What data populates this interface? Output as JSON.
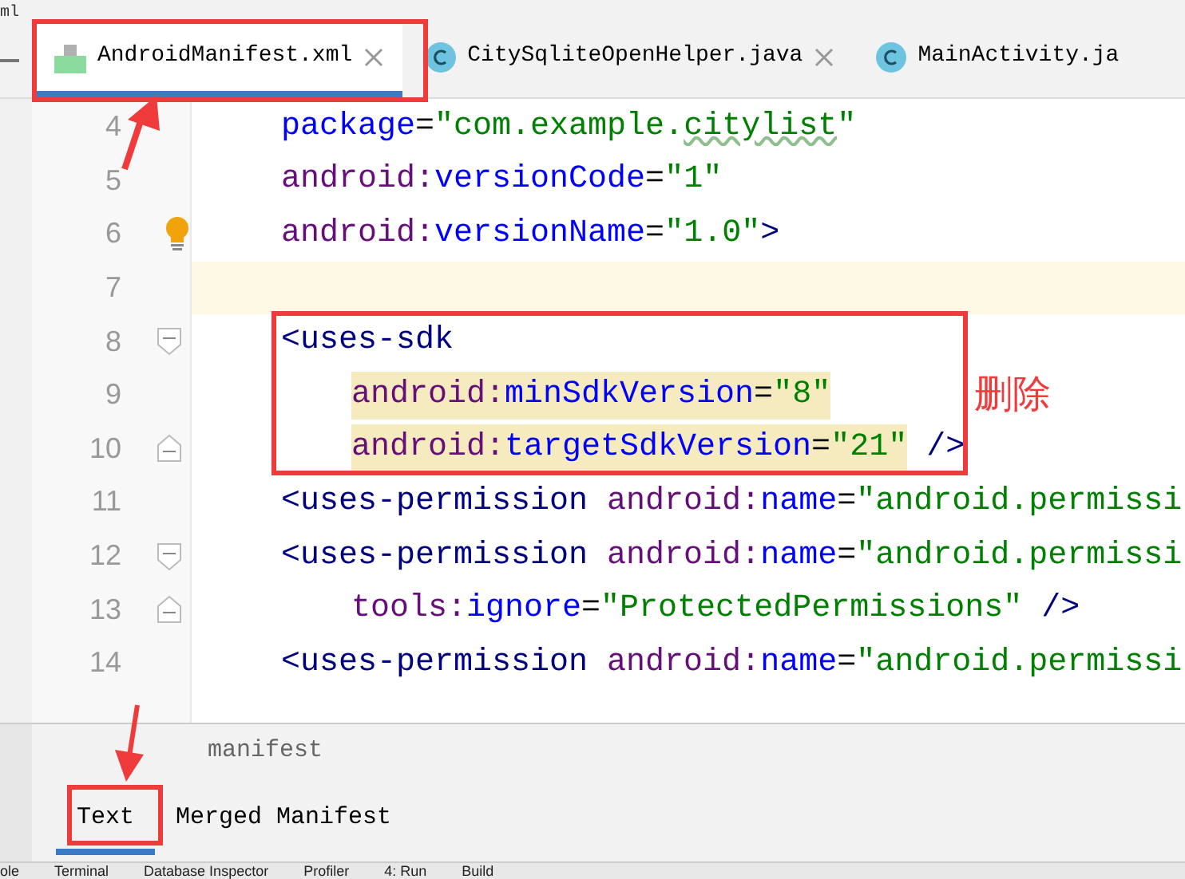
{
  "window": {
    "title_fragment": "ml"
  },
  "tabs": [
    {
      "label": "AndroidManifest.xml",
      "kind": "manifest",
      "selected": true,
      "closable": true
    },
    {
      "label": "CitySqliteOpenHelper.java",
      "kind": "class",
      "selected": false,
      "closable": true
    },
    {
      "label": "MainActivity.ja",
      "kind": "class",
      "selected": false,
      "closable": false
    }
  ],
  "editor": {
    "lines": [
      {
        "number": "4",
        "current": false,
        "nested": false,
        "segments": [
          {
            "highlighted": false,
            "tokens": [
              {
                "kind": "attr",
                "text": "package"
              },
              {
                "kind": "eq",
                "text": "="
              },
              {
                "kind": "value",
                "text": "\"com.example."
              },
              {
                "kind": "typo",
                "text": "citylist"
              },
              {
                "kind": "value",
                "text": "\""
              }
            ]
          }
        ]
      },
      {
        "number": "5",
        "current": false,
        "nested": false,
        "segments": [
          {
            "highlighted": false,
            "tokens": [
              {
                "kind": "ns",
                "text": "android:"
              },
              {
                "kind": "attr",
                "text": "versionCode"
              },
              {
                "kind": "eq",
                "text": "="
              },
              {
                "kind": "value",
                "text": "\"1\""
              }
            ]
          }
        ]
      },
      {
        "number": "6",
        "current": false,
        "nested": false,
        "marker": {
          "kind": "bulb"
        },
        "segments": [
          {
            "highlighted": false,
            "tokens": [
              {
                "kind": "ns",
                "text": "android:"
              },
              {
                "kind": "attr",
                "text": "versionName"
              },
              {
                "kind": "eq",
                "text": "="
              },
              {
                "kind": "value",
                "text": "\"1.0\""
              },
              {
                "kind": "tag",
                "text": ">"
              }
            ]
          }
        ]
      },
      {
        "number": "7",
        "current": true,
        "nested": false
      },
      {
        "number": "8",
        "current": false,
        "nested": false,
        "marker": {
          "kind": "fold-start"
        },
        "segments": [
          {
            "highlighted": false,
            "tokens": [
              {
                "kind": "tag",
                "text": "<uses-sdk"
              }
            ]
          }
        ]
      },
      {
        "number": "9",
        "current": false,
        "nested": true,
        "segments": [
          {
            "highlighted": true,
            "tokens": [
              {
                "kind": "ns",
                "text": "android:"
              },
              {
                "kind": "attr",
                "text": "minSdkVersion"
              },
              {
                "kind": "eq",
                "text": "="
              },
              {
                "kind": "value",
                "text": "\"8\""
              }
            ]
          }
        ]
      },
      {
        "number": "10",
        "current": false,
        "nested": true,
        "marker": {
          "kind": "fold-end"
        },
        "segments": [
          {
            "highlighted": true,
            "tokens": [
              {
                "kind": "ns",
                "text": "android:"
              },
              {
                "kind": "attr",
                "text": "targetSdkVersion"
              },
              {
                "kind": "eq",
                "text": "="
              },
              {
                "kind": "value",
                "text": "\"21\""
              }
            ]
          },
          {
            "highlighted": false,
            "tokens": [
              {
                "kind": "tag",
                "text": " />"
              }
            ]
          }
        ]
      },
      {
        "number": "11",
        "current": false,
        "nested": false,
        "segments": [
          {
            "highlighted": false,
            "tokens": [
              {
                "kind": "tag",
                "text": "<uses-permission "
              },
              {
                "kind": "ns",
                "text": "android:"
              },
              {
                "kind": "attr",
                "text": "name"
              },
              {
                "kind": "eq",
                "text": "="
              },
              {
                "kind": "value",
                "text": "\"android.permissi"
              }
            ]
          }
        ]
      },
      {
        "number": "12",
        "current": false,
        "nested": false,
        "marker": {
          "kind": "fold-start"
        },
        "segments": [
          {
            "highlighted": false,
            "tokens": [
              {
                "kind": "tag",
                "text": "<uses-permission "
              },
              {
                "kind": "ns",
                "text": "android:"
              },
              {
                "kind": "attr",
                "text": "name"
              },
              {
                "kind": "eq",
                "text": "="
              },
              {
                "kind": "value",
                "text": "\"android.permissi"
              }
            ]
          }
        ]
      },
      {
        "number": "13",
        "current": false,
        "nested": true,
        "marker": {
          "kind": "fold-end"
        },
        "segments": [
          {
            "highlighted": false,
            "tokens": [
              {
                "kind": "ns",
                "text": "tools:"
              },
              {
                "kind": "attr",
                "text": "ignore"
              },
              {
                "kind": "eq",
                "text": "="
              },
              {
                "kind": "value",
                "text": "\"ProtectedPermissions\""
              },
              {
                "kind": "tag",
                "text": " />"
              }
            ]
          }
        ]
      },
      {
        "number": "14",
        "current": false,
        "nested": false,
        "segments": [
          {
            "highlighted": false,
            "tokens": [
              {
                "kind": "tag",
                "text": "<uses-permission "
              },
              {
                "kind": "ns",
                "text": "android:"
              },
              {
                "kind": "attr",
                "text": "name"
              },
              {
                "kind": "eq",
                "text": "="
              },
              {
                "kind": "value",
                "text": "\"android.permissi"
              }
            ]
          }
        ]
      }
    ]
  },
  "annotation": {
    "note": "删除"
  },
  "breadcrumb": "manifest",
  "bottom_tabs": [
    {
      "label": "Text",
      "selected": true
    },
    {
      "label": "Merged Manifest",
      "selected": false
    }
  ],
  "tool_strip": [
    "ole",
    "Terminal",
    "Database Inspector",
    "Profiler",
    "4: Run",
    "Build"
  ]
}
